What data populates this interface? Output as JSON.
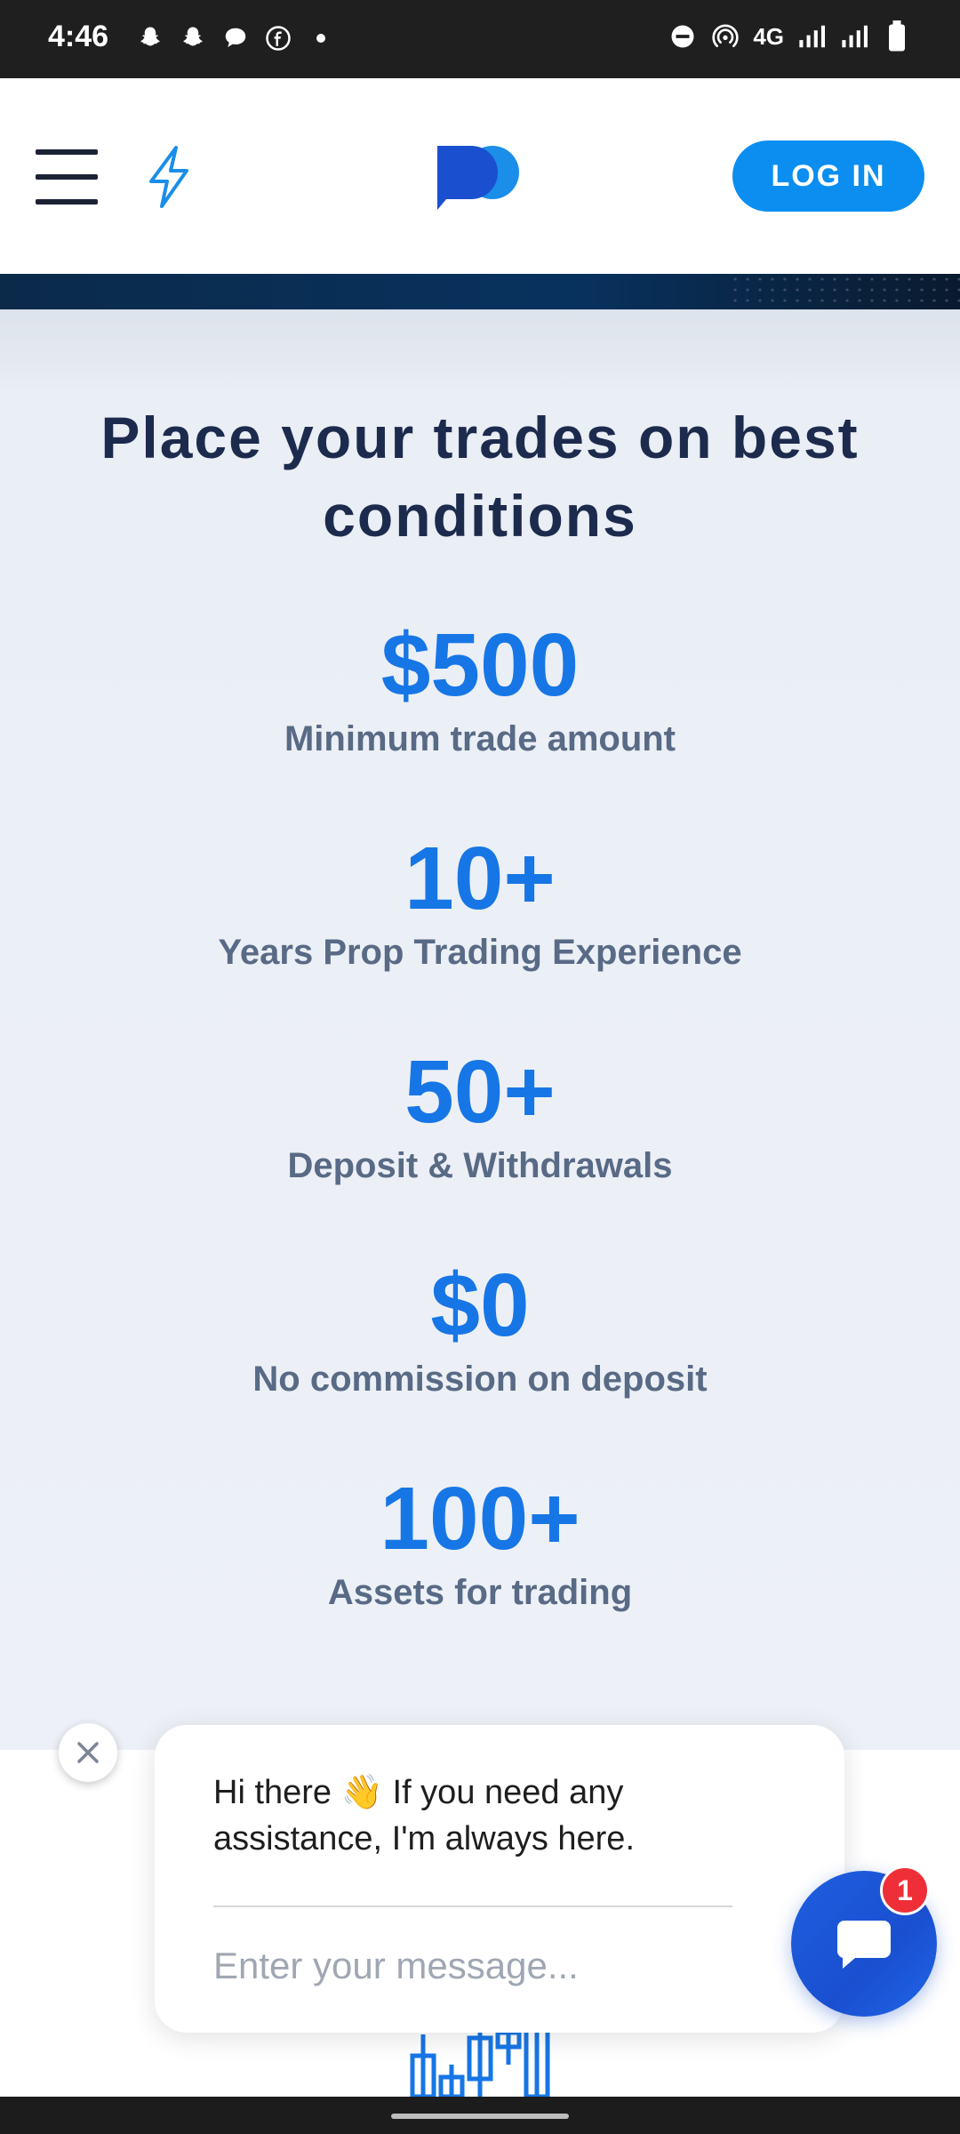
{
  "status_bar": {
    "time": "4:46",
    "network": "4G",
    "left_icons": [
      "snapchat-icon",
      "snapchat-icon",
      "chat-bubble-icon",
      "facebook-icon",
      "dot-icon"
    ],
    "right_icons": [
      "do-not-disturb-icon",
      "hotspot-icon",
      "signal-icon",
      "signal-icon",
      "battery-icon"
    ]
  },
  "header": {
    "login_label": "LOG IN",
    "brand_color": "#0b8ef0"
  },
  "stats_section": {
    "title": "Place your trades on best conditions",
    "items": [
      {
        "value": "$500",
        "label": "Minimum trade amount"
      },
      {
        "value": "10+",
        "label": "Years Prop Trading Experience"
      },
      {
        "value": "50+",
        "label": "Deposit & Withdrawals"
      },
      {
        "value": "$0",
        "label": "No commission on deposit"
      },
      {
        "value": "100+",
        "label": "Assets for trading"
      }
    ],
    "value_color": "#1776e6"
  },
  "chat": {
    "greeting_start": "Hi there ",
    "greeting_emoji": "👋",
    "greeting_end": " If you need any assistance, I'm always here.",
    "input_placeholder": "Enter your message...",
    "unread_count": "1"
  }
}
